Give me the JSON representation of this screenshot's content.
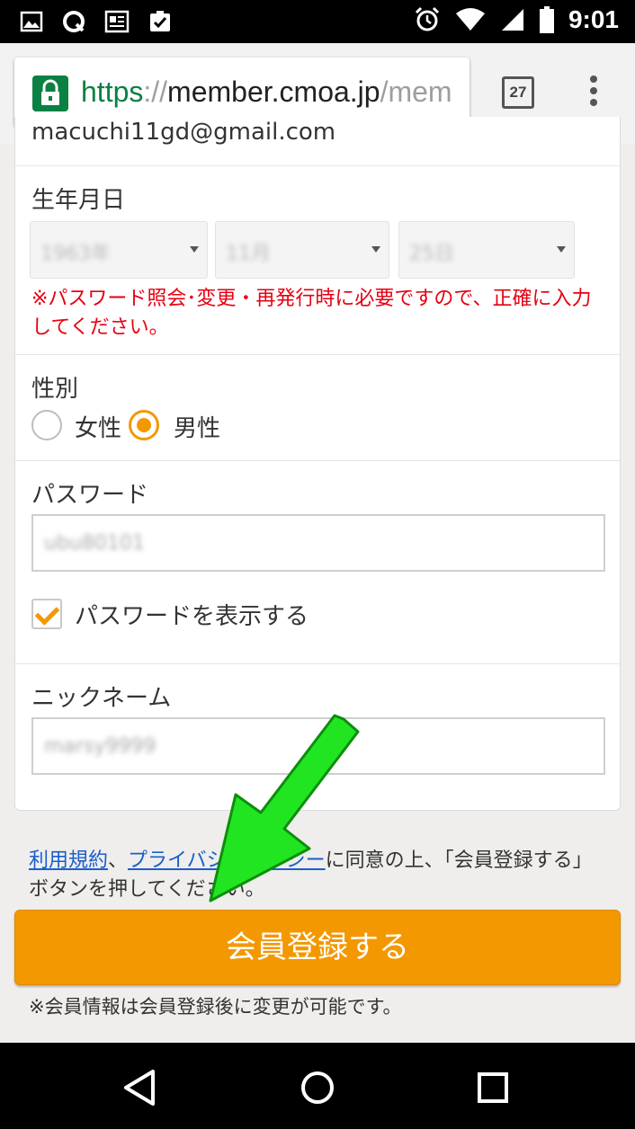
{
  "status_bar": {
    "time": "9:01",
    "left_icons": [
      "image-icon",
      "q-app-icon",
      "news-icon",
      "task-icon"
    ],
    "right_icons": [
      "alarm-icon",
      "wifi-icon",
      "signal-icon",
      "battery-icon"
    ]
  },
  "browser": {
    "url_scheme": "https",
    "url_sep": "://",
    "url_host": "member.cmoa.jp",
    "url_path": "/mem",
    "tab_count": "27"
  },
  "form": {
    "email_partial": "macuchi11gd@gmail.com",
    "birthdate": {
      "label": "生年月日",
      "year": "1963年",
      "month": "11月",
      "day": "25日",
      "note": "※パスワード照会･変更・再発行時に必要ですので、正確に入力してください。"
    },
    "gender": {
      "label": "性別",
      "options": [
        "女性",
        "男性"
      ],
      "selected": "男性"
    },
    "password": {
      "label": "パスワード",
      "value": "ubu80101",
      "show_label": "パスワードを表示する",
      "show_checked": true
    },
    "nickname": {
      "label": "ニックネーム",
      "value": "marsy9999"
    }
  },
  "consent": {
    "terms_link": "利用規約",
    "comma": "、",
    "privacy_link": "プライバシーポリシー",
    "text": "に同意の上、「会員登録する」ボタンを押してください。"
  },
  "submit_label": "会員登録する",
  "after_note": "※会員情報は会員登録後に変更が可能です。",
  "colors": {
    "accent": "#f39800",
    "link": "#1a5fcc",
    "warning": "#e60012",
    "secure": "#0b8043",
    "arrow": "#22dd22"
  }
}
